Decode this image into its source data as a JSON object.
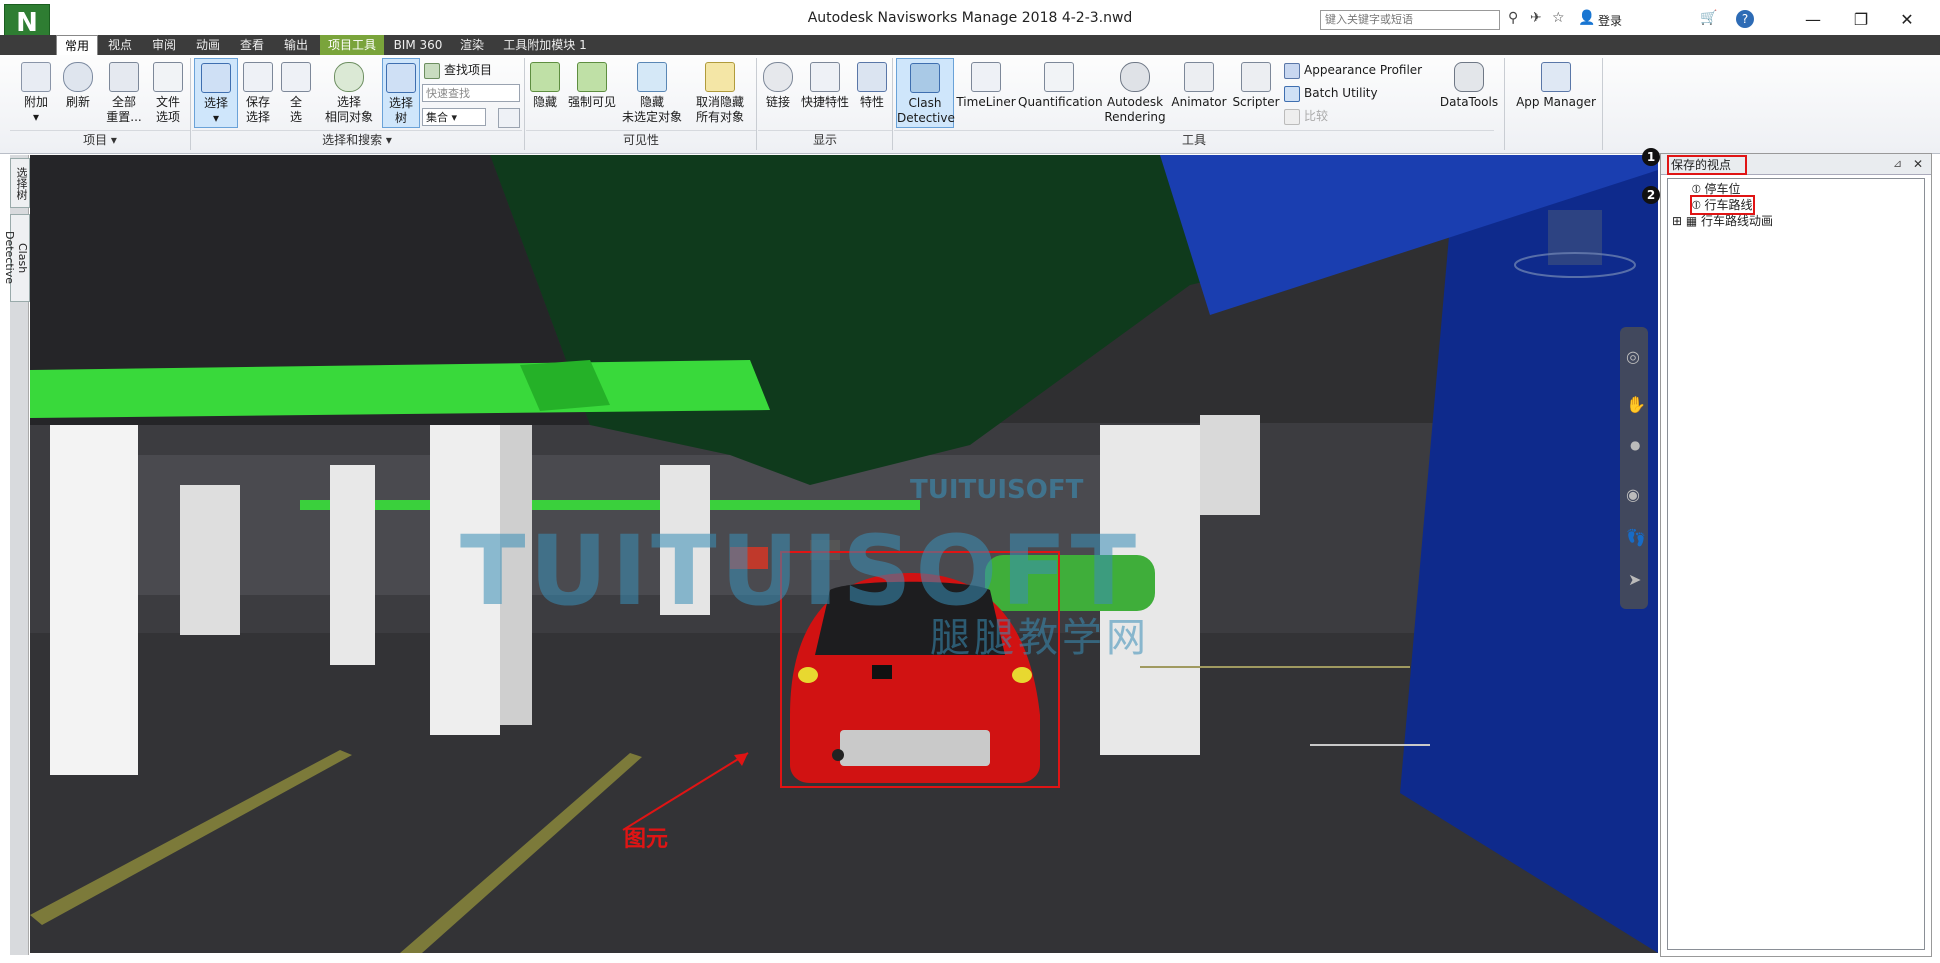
{
  "window": {
    "title": "Autodesk Navisworks Manage 2018    4-2-3.nwd",
    "logo_letter": "N",
    "search_placeholder": "键入关键字或短语",
    "login_label": "登录",
    "minimize": "—",
    "restore": "❐",
    "close": "✕"
  },
  "tabs": [
    {
      "label": "常用"
    },
    {
      "label": "视点"
    },
    {
      "label": "审阅"
    },
    {
      "label": "动画"
    },
    {
      "label": "查看"
    },
    {
      "label": "输出"
    },
    {
      "label": "项目工具"
    },
    {
      "label": "BIM 360"
    },
    {
      "label": "渲染"
    },
    {
      "label": "工具附加模块 1"
    }
  ],
  "ribbon": {
    "project": {
      "label": "项目 ▾",
      "buttons": [
        {
          "line1": "附加",
          "line2": "▾"
        },
        {
          "line1": "刷新",
          "line2": ""
        },
        {
          "line1": "全部",
          "line2": "重置..."
        },
        {
          "line1": "文件",
          "line2": "选项"
        }
      ]
    },
    "select_search": {
      "label": "选择和搜索 ▾",
      "buttons": [
        {
          "line1": "选择",
          "line2": "▾"
        },
        {
          "line1": "保存",
          "line2": "选择"
        },
        {
          "line1": "全",
          "line2": "选"
        },
        {
          "line1": "选择",
          "line2": "相同对象"
        },
        {
          "line1": "选择",
          "line2": "树"
        }
      ],
      "find_items": "查找项目",
      "quick_find_placeholder": "快速查找",
      "sets": "集合"
    },
    "visibility": {
      "label": "可见性",
      "buttons": [
        {
          "line1": "隐藏",
          "line2": ""
        },
        {
          "line1": "强制可见",
          "line2": ""
        },
        {
          "line1": "隐藏",
          "line2": "未选定对象"
        },
        {
          "line1": "取消隐藏",
          "line2": "所有对象"
        }
      ]
    },
    "display": {
      "label": "显示",
      "buttons": [
        {
          "line1": "链接",
          "line2": ""
        },
        {
          "line1": "快捷特性",
          "line2": ""
        },
        {
          "line1": "特性",
          "line2": ""
        }
      ]
    },
    "tools": {
      "label": "工具",
      "buttons": [
        {
          "line1": "Clash",
          "line2": "Detective"
        },
        {
          "line1": "TimeLiner",
          "line2": ""
        },
        {
          "line1": "Quantification",
          "line2": ""
        },
        {
          "line1": "Autodesk",
          "line2": "Rendering"
        },
        {
          "line1": "Animator",
          "line2": ""
        },
        {
          "line1": "Scripter",
          "line2": ""
        }
      ],
      "small": [
        "Appearance Profiler",
        "Batch Utility",
        "比较"
      ]
    },
    "extra": [
      {
        "line1": "DataTools",
        "line2": ""
      },
      {
        "line1": "App Manager",
        "line2": ""
      }
    ]
  },
  "left_tabs": [
    "选择树",
    "Clash Detective"
  ],
  "viewport": {
    "annotation_label": "图元",
    "watermark_big": "TUITUISOFT",
    "watermark_small": "TUITUISOFT",
    "watermark_cn": "腿腿教学网"
  },
  "panel": {
    "title": "保存的视点",
    "items": [
      {
        "label": "停车位"
      },
      {
        "label": "行车路线"
      },
      {
        "label": "行车路线动画"
      }
    ],
    "badges": [
      "1",
      "2"
    ]
  }
}
